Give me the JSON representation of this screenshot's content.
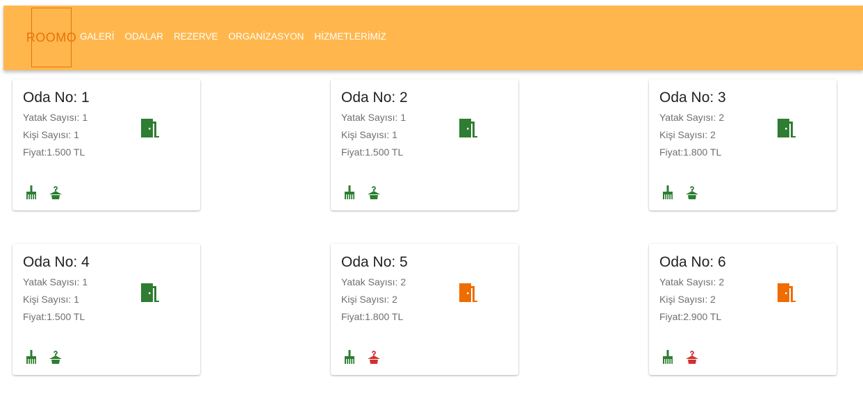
{
  "app": {
    "logo": "ROOMO"
  },
  "nav": [
    {
      "label": "GALERİ"
    },
    {
      "label": "ODALAR"
    },
    {
      "label": "REZERVE"
    },
    {
      "label": "ORGANİZASYON"
    },
    {
      "label": "HİZMETLERİMİZ"
    }
  ],
  "colors": {
    "header": "#ffb74d",
    "available": "#2e7d32",
    "occupied": "#ef6c00",
    "alert": "#d32f2f"
  },
  "rooms": [
    {
      "title": "Oda No: 1",
      "beds": "Yatak Sayısı: 1",
      "persons": "Kişi Sayısı: 1",
      "price": "Fiyat:1.500 TL",
      "door_status": "available",
      "cleaning_status": "ok",
      "service_status": "ok"
    },
    {
      "title": "Oda No: 2",
      "beds": "Yatak Sayısı: 1",
      "persons": "Kişi Sayısı: 1",
      "price": "Fiyat:1.500 TL",
      "door_status": "available",
      "cleaning_status": "ok",
      "service_status": "ok"
    },
    {
      "title": "Oda No: 3",
      "beds": "Yatak Sayısı: 2",
      "persons": "Kişi Sayısı: 2",
      "price": "Fiyat:1.800 TL",
      "door_status": "available",
      "cleaning_status": "ok",
      "service_status": "ok"
    },
    {
      "title": "Oda No: 4",
      "beds": "Yatak Sayısı: 1",
      "persons": "Kişi Sayısı: 1",
      "price": "Fiyat:1.500 TL",
      "door_status": "available",
      "cleaning_status": "ok",
      "service_status": "ok"
    },
    {
      "title": "Oda No: 5",
      "beds": "Yatak Sayısı: 2",
      "persons": "Kişi Sayısı: 2",
      "price": "Fiyat:1.800 TL",
      "door_status": "occupied",
      "cleaning_status": "ok",
      "service_status": "alert"
    },
    {
      "title": "Oda No: 6",
      "beds": "Yatak Sayısı: 2",
      "persons": "Kişi Sayısı: 2",
      "price": "Fiyat:2.900 TL",
      "door_status": "occupied",
      "cleaning_status": "ok",
      "service_status": "alert"
    }
  ]
}
